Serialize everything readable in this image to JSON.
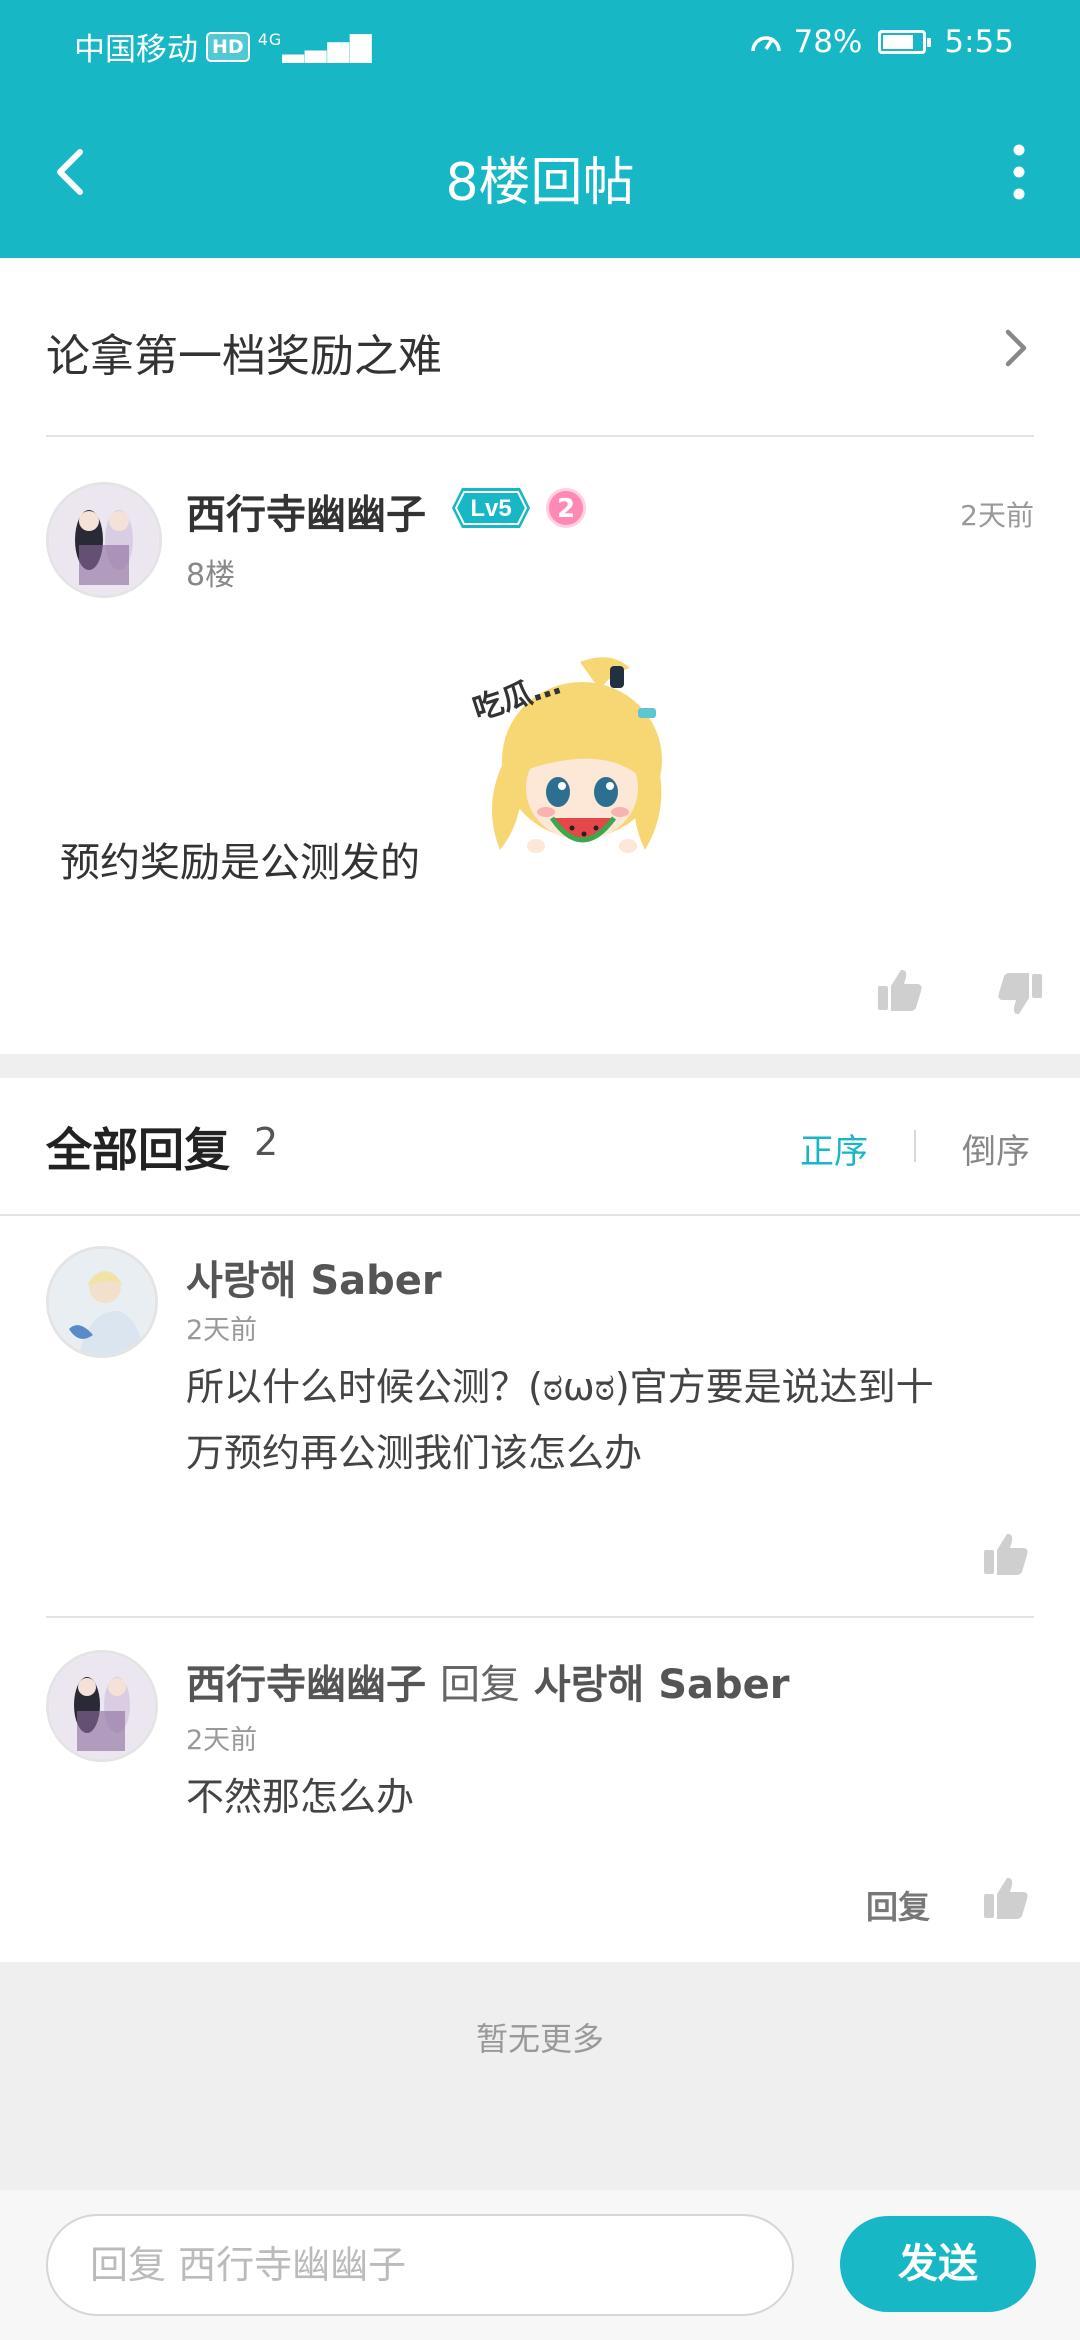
{
  "status_bar": {
    "carrier": "中国移动",
    "hd_badge": "HD",
    "network": "4G",
    "battery": "78%",
    "battery_level": 0.78,
    "time": "5:55"
  },
  "header": {
    "title": "8楼回帖",
    "back_icon": "chevron-left-icon",
    "more_icon": "more-vertical-icon"
  },
  "post_title": {
    "text": "论拿第一档奖励之难"
  },
  "post": {
    "author": "西行寺幽幽子",
    "level": "Lv5",
    "medal": "2",
    "floor": "8楼",
    "time": "2天前",
    "content": "预约奖励是公测发的",
    "sticker_text": "吃瓜…"
  },
  "replies_header": {
    "title": "全部回复",
    "count": "2",
    "sort_asc": "正序",
    "sort_desc": "倒序"
  },
  "replies": [
    {
      "author": "사랑해 Saber",
      "time": "2天前",
      "content_line1": "所以什么时候公测？(ಠωಠ)官方要是说达到十",
      "content_line2": "万预约再公测我们该怎么办"
    },
    {
      "author": "西行寺幽幽子",
      "reply_word": "回复",
      "reply_to": "사랑해 Saber",
      "time": "2天前",
      "content": "不然那怎么办",
      "reply_action": "回复"
    }
  ],
  "footer": {
    "no_more": "暂无更多"
  },
  "bottom_bar": {
    "placeholder": "回复 西行寺幽幽子",
    "send": "发送"
  },
  "colors": {
    "accent": "#17b7c6",
    "medal": "#ff88b4"
  }
}
